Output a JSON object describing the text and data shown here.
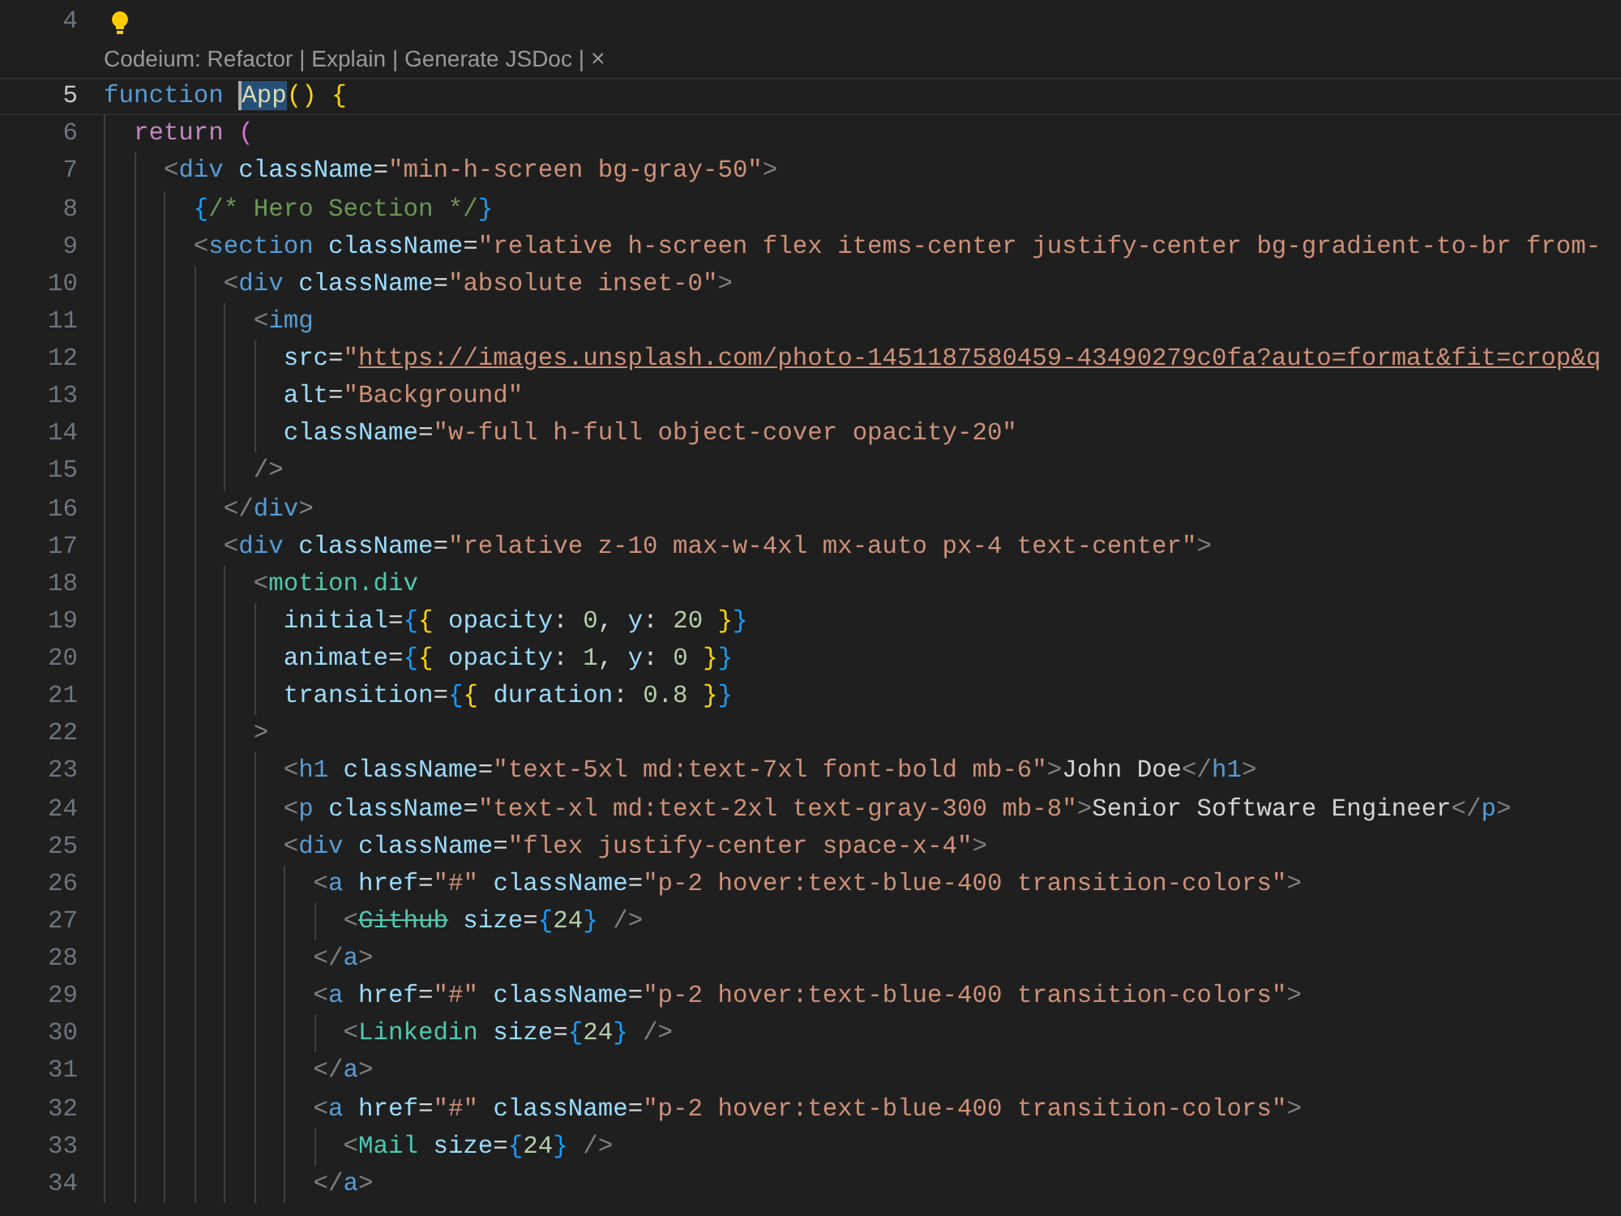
{
  "lines": [
    {
      "number": "4",
      "lightbulb": true,
      "current": false
    },
    {
      "kind": "codelens",
      "text": "Codeium: Refactor | Explain | Generate JSDoc |",
      "close": "×"
    },
    {
      "number": "5",
      "lightbulb": false,
      "current": true,
      "tokens": [
        {
          "t": "function ",
          "kind": "keyword"
        },
        {
          "t": "App",
          "kind": "selected-fn"
        },
        {
          "t": "()",
          "kind": "b1"
        },
        {
          "t": " {",
          "kind": "b1"
        }
      ]
    },
    {
      "number": "6",
      "lightbulb": false,
      "current": false,
      "tokens": [
        {
          "t": "  return",
          "kind": "control"
        },
        {
          "t": " (",
          "kind": "b2"
        }
      ]
    },
    {
      "number": "7",
      "lightbulb": false,
      "current": false,
      "tokens": [
        {
          "t": "    <",
          "kind": "tagp"
        },
        {
          "t": "div",
          "kind": "tag"
        },
        {
          "t": " className",
          "kind": "attr"
        },
        {
          "t": "=",
          "kind": "text"
        },
        {
          "t": "\"min-h-screen bg-gray-50\"",
          "kind": "str"
        },
        {
          "t": ">",
          "kind": "tagp"
        }
      ]
    },
    {
      "number": "8",
      "lightbulb": false,
      "current": false,
      "tokens": [
        {
          "t": "      {",
          "kind": "b3"
        },
        {
          "t": "/* Hero Section */",
          "kind": "comment"
        },
        {
          "t": "}",
          "kind": "b3"
        }
      ]
    },
    {
      "number": "9",
      "lightbulb": false,
      "current": false,
      "tokens": [
        {
          "t": "      <",
          "kind": "tagp"
        },
        {
          "t": "section",
          "kind": "tag"
        },
        {
          "t": " className",
          "kind": "attr"
        },
        {
          "t": "=",
          "kind": "text"
        },
        {
          "t": "\"relative h-screen flex items-center justify-center bg-gradient-to-br from-",
          "kind": "str"
        }
      ]
    },
    {
      "number": "10",
      "lightbulb": false,
      "current": false,
      "tokens": [
        {
          "t": "        <",
          "kind": "tagp"
        },
        {
          "t": "div",
          "kind": "tag"
        },
        {
          "t": " className",
          "kind": "attr"
        },
        {
          "t": "=",
          "kind": "text"
        },
        {
          "t": "\"absolute inset-0\"",
          "kind": "str"
        },
        {
          "t": ">",
          "kind": "tagp"
        }
      ]
    },
    {
      "number": "11",
      "lightbulb": false,
      "current": false,
      "tokens": [
        {
          "t": "          <",
          "kind": "tagp"
        },
        {
          "t": "img",
          "kind": "tag"
        }
      ]
    },
    {
      "number": "12",
      "lightbulb": false,
      "current": false,
      "tokens": [
        {
          "t": "            src",
          "kind": "attr"
        },
        {
          "t": "=",
          "kind": "text"
        },
        {
          "t": "\"",
          "kind": "str"
        },
        {
          "t": "https://images.unsplash.com/photo-1451187580459-43490279c0fa?auto=format&fit=crop&q",
          "kind": "link"
        }
      ]
    },
    {
      "number": "13",
      "lightbulb": false,
      "current": false,
      "tokens": [
        {
          "t": "            alt",
          "kind": "attr"
        },
        {
          "t": "=",
          "kind": "text"
        },
        {
          "t": "\"Background\"",
          "kind": "str"
        }
      ]
    },
    {
      "number": "14",
      "lightbulb": false,
      "current": false,
      "tokens": [
        {
          "t": "            className",
          "kind": "attr"
        },
        {
          "t": "=",
          "kind": "text"
        },
        {
          "t": "\"w-full h-full object-cover opacity-20\"",
          "kind": "str"
        }
      ]
    },
    {
      "number": "15",
      "lightbulb": false,
      "current": false,
      "tokens": [
        {
          "t": "          />",
          "kind": "tagp"
        }
      ]
    },
    {
      "number": "16",
      "lightbulb": false,
      "current": false,
      "tokens": [
        {
          "t": "        </",
          "kind": "tagp"
        },
        {
          "t": "div",
          "kind": "tag"
        },
        {
          "t": ">",
          "kind": "tagp"
        }
      ]
    },
    {
      "number": "17",
      "lightbulb": false,
      "current": false,
      "tokens": [
        {
          "t": "        <",
          "kind": "tagp"
        },
        {
          "t": "div",
          "kind": "tag"
        },
        {
          "t": " className",
          "kind": "attr"
        },
        {
          "t": "=",
          "kind": "text"
        },
        {
          "t": "\"relative z-10 max-w-4xl mx-auto px-4 text-center\"",
          "kind": "str"
        },
        {
          "t": ">",
          "kind": "tagp"
        }
      ]
    },
    {
      "number": "18",
      "lightbulb": false,
      "current": false,
      "tokens": [
        {
          "t": "          <",
          "kind": "tagp"
        },
        {
          "t": "motion.div",
          "kind": "comp"
        }
      ]
    },
    {
      "number": "19",
      "lightbulb": false,
      "current": false,
      "tokens": [
        {
          "t": "            initial",
          "kind": "attr"
        },
        {
          "t": "=",
          "kind": "text"
        },
        {
          "t": "{",
          "kind": "b3"
        },
        {
          "t": "{",
          "kind": "b1"
        },
        {
          "t": " opacity",
          "kind": "attr"
        },
        {
          "t": ": ",
          "kind": "text"
        },
        {
          "t": "0",
          "kind": "num"
        },
        {
          "t": ", ",
          "kind": "text"
        },
        {
          "t": "y",
          "kind": "attr"
        },
        {
          "t": ": ",
          "kind": "text"
        },
        {
          "t": "20",
          "kind": "num"
        },
        {
          "t": " }",
          "kind": "b1"
        },
        {
          "t": "}",
          "kind": "b3"
        }
      ]
    },
    {
      "number": "20",
      "lightbulb": false,
      "current": false,
      "tokens": [
        {
          "t": "            animate",
          "kind": "attr"
        },
        {
          "t": "=",
          "kind": "text"
        },
        {
          "t": "{",
          "kind": "b3"
        },
        {
          "t": "{",
          "kind": "b1"
        },
        {
          "t": " opacity",
          "kind": "attr"
        },
        {
          "t": ": ",
          "kind": "text"
        },
        {
          "t": "1",
          "kind": "num"
        },
        {
          "t": ", ",
          "kind": "text"
        },
        {
          "t": "y",
          "kind": "attr"
        },
        {
          "t": ": ",
          "kind": "text"
        },
        {
          "t": "0",
          "kind": "num"
        },
        {
          "t": " }",
          "kind": "b1"
        },
        {
          "t": "}",
          "kind": "b3"
        }
      ]
    },
    {
      "number": "21",
      "lightbulb": false,
      "current": false,
      "tokens": [
        {
          "t": "            transition",
          "kind": "attr"
        },
        {
          "t": "=",
          "kind": "text"
        },
        {
          "t": "{",
          "kind": "b3"
        },
        {
          "t": "{",
          "kind": "b1"
        },
        {
          "t": " duration",
          "kind": "attr"
        },
        {
          "t": ": ",
          "kind": "text"
        },
        {
          "t": "0.8",
          "kind": "num"
        },
        {
          "t": " }",
          "kind": "b1"
        },
        {
          "t": "}",
          "kind": "b3"
        }
      ]
    },
    {
      "number": "22",
      "lightbulb": false,
      "current": false,
      "tokens": [
        {
          "t": "          >",
          "kind": "tagp"
        }
      ]
    },
    {
      "number": "23",
      "lightbulb": false,
      "current": false,
      "tokens": [
        {
          "t": "            <",
          "kind": "tagp"
        },
        {
          "t": "h1",
          "kind": "tag"
        },
        {
          "t": " className",
          "kind": "attr"
        },
        {
          "t": "=",
          "kind": "text"
        },
        {
          "t": "\"text-5xl md:text-7xl font-bold mb-6\"",
          "kind": "str"
        },
        {
          "t": ">",
          "kind": "tagp"
        },
        {
          "t": "John Doe",
          "kind": "text"
        },
        {
          "t": "</",
          "kind": "tagp"
        },
        {
          "t": "h1",
          "kind": "tag"
        },
        {
          "t": ">",
          "kind": "tagp"
        }
      ]
    },
    {
      "number": "24",
      "lightbulb": false,
      "current": false,
      "tokens": [
        {
          "t": "            <",
          "kind": "tagp"
        },
        {
          "t": "p",
          "kind": "tag"
        },
        {
          "t": " className",
          "kind": "attr"
        },
        {
          "t": "=",
          "kind": "text"
        },
        {
          "t": "\"text-xl md:text-2xl text-gray-300 mb-8\"",
          "kind": "str"
        },
        {
          "t": ">",
          "kind": "tagp"
        },
        {
          "t": "Senior Software Engineer",
          "kind": "text"
        },
        {
          "t": "</",
          "kind": "tagp"
        },
        {
          "t": "p",
          "kind": "tag"
        },
        {
          "t": ">",
          "kind": "tagp"
        }
      ]
    },
    {
      "number": "25",
      "lightbulb": false,
      "current": false,
      "tokens": [
        {
          "t": "            <",
          "kind": "tagp"
        },
        {
          "t": "div",
          "kind": "tag"
        },
        {
          "t": " className",
          "kind": "attr"
        },
        {
          "t": "=",
          "kind": "text"
        },
        {
          "t": "\"flex justify-center space-x-4\"",
          "kind": "str"
        },
        {
          "t": ">",
          "kind": "tagp"
        }
      ]
    },
    {
      "number": "26",
      "lightbulb": false,
      "current": false,
      "tokens": [
        {
          "t": "              <",
          "kind": "tagp"
        },
        {
          "t": "a",
          "kind": "tag"
        },
        {
          "t": " href",
          "kind": "attr"
        },
        {
          "t": "=",
          "kind": "text"
        },
        {
          "t": "\"#\"",
          "kind": "str"
        },
        {
          "t": " className",
          "kind": "attr"
        },
        {
          "t": "=",
          "kind": "text"
        },
        {
          "t": "\"p-2 hover:text-blue-400 transition-colors\"",
          "kind": "str"
        },
        {
          "t": ">",
          "kind": "tagp"
        }
      ]
    },
    {
      "number": "27",
      "lightbulb": false,
      "current": false,
      "tokens": [
        {
          "t": "                <",
          "kind": "tagp"
        },
        {
          "t": "Github",
          "kind": "deprecated"
        },
        {
          "t": " size",
          "kind": "attr"
        },
        {
          "t": "=",
          "kind": "text"
        },
        {
          "t": "{",
          "kind": "b3"
        },
        {
          "t": "24",
          "kind": "num"
        },
        {
          "t": "}",
          "kind": "b3"
        },
        {
          "t": " />",
          "kind": "tagp"
        }
      ]
    },
    {
      "number": "28",
      "lightbulb": false,
      "current": false,
      "tokens": [
        {
          "t": "              </",
          "kind": "tagp"
        },
        {
          "t": "a",
          "kind": "tag"
        },
        {
          "t": ">",
          "kind": "tagp"
        }
      ]
    },
    {
      "number": "29",
      "lightbulb": false,
      "current": false,
      "tokens": [
        {
          "t": "              <",
          "kind": "tagp"
        },
        {
          "t": "a",
          "kind": "tag"
        },
        {
          "t": " href",
          "kind": "attr"
        },
        {
          "t": "=",
          "kind": "text"
        },
        {
          "t": "\"#\"",
          "kind": "str"
        },
        {
          "t": " className",
          "kind": "attr"
        },
        {
          "t": "=",
          "kind": "text"
        },
        {
          "t": "\"p-2 hover:text-blue-400 transition-colors\"",
          "kind": "str"
        },
        {
          "t": ">",
          "kind": "tagp"
        }
      ]
    },
    {
      "number": "30",
      "lightbulb": false,
      "current": false,
      "tokens": [
        {
          "t": "                <",
          "kind": "tagp"
        },
        {
          "t": "Linkedin",
          "kind": "comp"
        },
        {
          "t": " size",
          "kind": "attr"
        },
        {
          "t": "=",
          "kind": "text"
        },
        {
          "t": "{",
          "kind": "b3"
        },
        {
          "t": "24",
          "kind": "num"
        },
        {
          "t": "}",
          "kind": "b3"
        },
        {
          "t": " />",
          "kind": "tagp"
        }
      ]
    },
    {
      "number": "31",
      "lightbulb": false,
      "current": false,
      "tokens": [
        {
          "t": "              </",
          "kind": "tagp"
        },
        {
          "t": "a",
          "kind": "tag"
        },
        {
          "t": ">",
          "kind": "tagp"
        }
      ]
    },
    {
      "number": "32",
      "lightbulb": false,
      "current": false,
      "tokens": [
        {
          "t": "              <",
          "kind": "tagp"
        },
        {
          "t": "a",
          "kind": "tag"
        },
        {
          "t": " href",
          "kind": "attr"
        },
        {
          "t": "=",
          "kind": "text"
        },
        {
          "t": "\"#\"",
          "kind": "str"
        },
        {
          "t": " className",
          "kind": "attr"
        },
        {
          "t": "=",
          "kind": "text"
        },
        {
          "t": "\"p-2 hover:text-blue-400 transition-colors\"",
          "kind": "str"
        },
        {
          "t": ">",
          "kind": "tagp"
        }
      ]
    },
    {
      "number": "33",
      "lightbulb": false,
      "current": false,
      "tokens": [
        {
          "t": "                <",
          "kind": "tagp"
        },
        {
          "t": "Mail",
          "kind": "comp"
        },
        {
          "t": " size",
          "kind": "attr"
        },
        {
          "t": "=",
          "kind": "text"
        },
        {
          "t": "{",
          "kind": "b3"
        },
        {
          "t": "24",
          "kind": "num"
        },
        {
          "t": "}",
          "kind": "b3"
        },
        {
          "t": " />",
          "kind": "tagp"
        }
      ]
    },
    {
      "number": "34",
      "lightbulb": false,
      "current": false,
      "tokens": [
        {
          "t": "              </",
          "kind": "tagp"
        },
        {
          "t": "a",
          "kind": "tag"
        },
        {
          "t": ">",
          "kind": "tagp"
        }
      ]
    }
  ]
}
